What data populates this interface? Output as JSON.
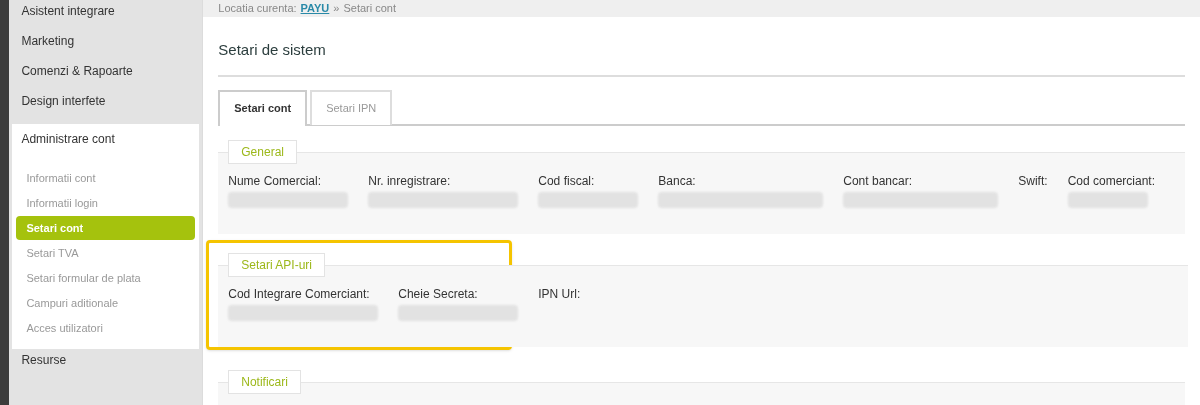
{
  "sidebar": {
    "items": [
      {
        "label": "Asistent integrare",
        "expanded": false
      },
      {
        "label": "Marketing",
        "expanded": false
      },
      {
        "label": "Comenzi & Rapoarte",
        "expanded": false
      },
      {
        "label": "Design interfete",
        "expanded": false
      },
      {
        "label": "Administrare cont",
        "expanded": true,
        "children": [
          {
            "label": "Informatii cont",
            "selected": false
          },
          {
            "label": "Informatii login",
            "selected": false
          },
          {
            "label": "Setari cont",
            "selected": true
          },
          {
            "label": "Setari TVA",
            "selected": false
          },
          {
            "label": "Setari formular de plata",
            "selected": false
          },
          {
            "label": "Campuri aditionale",
            "selected": false
          },
          {
            "label": "Acces utilizatori",
            "selected": false
          }
        ]
      },
      {
        "label": "Resurse",
        "expanded": false
      }
    ]
  },
  "breadcrumb": {
    "prefix": "Locatia curenta:",
    "link": "PAYU",
    "separator": "»",
    "current": "Setari cont"
  },
  "page_title": "Setari de sistem",
  "tabs": [
    {
      "label": "Setari cont",
      "selected": true
    },
    {
      "label": "Setari IPN",
      "selected": false
    }
  ],
  "sections": [
    {
      "title": "General",
      "highlighted": false,
      "fields": [
        {
          "label": "Nume Comercial:",
          "value_hidden": true
        },
        {
          "label": "Nr. inregistrare:",
          "value_hidden": true
        },
        {
          "label": "Cod fiscal:",
          "value_hidden": true
        },
        {
          "label": "Banca:",
          "value_hidden": true
        },
        {
          "label": "Cont bancar:",
          "value_hidden": true
        },
        {
          "label": "Swift:",
          "value_hidden": false
        },
        {
          "label": "Cod comerciant:",
          "value_hidden": true
        }
      ]
    },
    {
      "title": "Setari API-uri",
      "highlighted": true,
      "fields": [
        {
          "label": "Cod Integrare Comerciant:",
          "value_hidden": true
        },
        {
          "label": "Cheie Secreta:",
          "value_hidden": true
        },
        {
          "label": "IPN Url:",
          "value_hidden": false
        }
      ]
    },
    {
      "title": "Notificari",
      "highlighted": false
    }
  ]
}
